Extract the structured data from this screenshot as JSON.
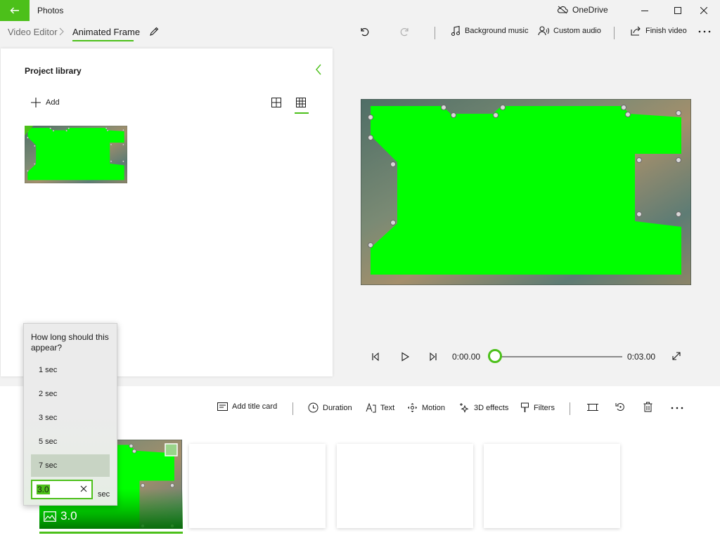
{
  "titlebar": {
    "app_title": "Photos",
    "onedrive_label": "OneDrive"
  },
  "breadcrumb": {
    "root": "Video Editor",
    "current": "Animated Frame"
  },
  "toolbar": {
    "background_music": "Background music",
    "custom_audio": "Custom audio",
    "finish_video": "Finish video"
  },
  "library": {
    "title": "Project library",
    "add_label": "Add"
  },
  "playback": {
    "current_time": "0:00.00",
    "total_time": "0:03.00",
    "progress": 0
  },
  "storyboard": {
    "tools": {
      "add_title_card": "Add title card",
      "duration": "Duration",
      "text": "Text",
      "motion": "Motion",
      "effects_3d": "3D effects",
      "filters": "Filters"
    },
    "clip_duration": "3.0"
  },
  "duration_flyout": {
    "question": "How long should this appear?",
    "options": [
      "1 sec",
      "2 sec",
      "3 sec",
      "5 sec",
      "7 sec"
    ],
    "selected_option": "7 sec",
    "input_value": "3.0",
    "unit": "sec"
  },
  "colors": {
    "accent": "#4cc01a",
    "chroma_green": "#00ff00",
    "frame_metal": "#5f7f76"
  }
}
